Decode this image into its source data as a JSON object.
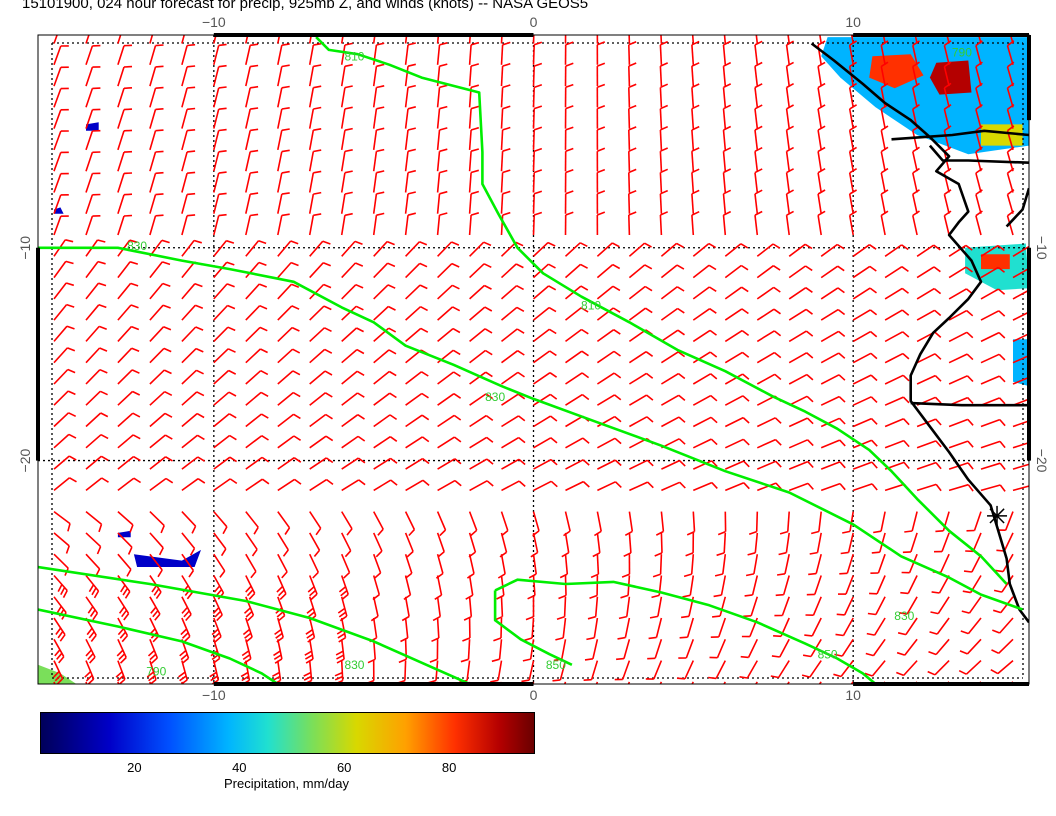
{
  "title": "15101900, 024 hour forecast for precip, 925mb Z, and winds (knots) -- NASA GEOS5",
  "lon_ticks": [
    {
      "value": -10,
      "label": "−10"
    },
    {
      "value": 0,
      "label": "0"
    },
    {
      "value": 10,
      "label": "10"
    }
  ],
  "lat_ticks": [
    {
      "value": -10,
      "label": "−10"
    },
    {
      "value": -20,
      "label": "−20"
    }
  ],
  "map_extent": {
    "lon_min": -15.5,
    "lon_max": 15.5,
    "lat_max": 0,
    "lat_min": -30.5
  },
  "contours": [
    {
      "label": "810",
      "color": "#00ee00",
      "points": [
        [
          -6.8,
          -0.1
        ],
        [
          -6.4,
          -0.7
        ],
        [
          -5.5,
          -0.9
        ],
        [
          -4.5,
          -1.4
        ],
        [
          -3.5,
          -2.0
        ],
        [
          -1.7,
          -2.7
        ],
        [
          -1.6,
          -5.5
        ],
        [
          -1.6,
          -7.0
        ],
        [
          -1.1,
          -8.4
        ],
        [
          -0.5,
          -10.0
        ],
        [
          0.3,
          -11.2
        ],
        [
          1.5,
          -12.3
        ],
        [
          3.0,
          -13.5
        ],
        [
          4.5,
          -14.8
        ],
        [
          6.0,
          -15.8
        ],
        [
          7.5,
          -17.0
        ],
        [
          8.5,
          -17.7
        ],
        [
          9.5,
          -18.5
        ],
        [
          10.5,
          -19.5
        ],
        [
          11.2,
          -20.5
        ],
        [
          12.0,
          -21.8
        ],
        [
          13.0,
          -23.3
        ],
        [
          14.0,
          -24.5
        ],
        [
          14.8,
          -25.8
        ]
      ]
    },
    {
      "label": "830",
      "color": "#00ee00",
      "points": [
        [
          -15.5,
          -10.0
        ],
        [
          -13.0,
          -10.0
        ],
        [
          -11.0,
          -10.6
        ],
        [
          -9.5,
          -11.0
        ],
        [
          -7.5,
          -11.6
        ],
        [
          -6.0,
          -12.8
        ],
        [
          -5.0,
          -13.5
        ],
        [
          -4.0,
          -14.6
        ],
        [
          -2.5,
          -15.5
        ],
        [
          -1.0,
          -16.5
        ],
        [
          0.0,
          -17.1
        ],
        [
          2.0,
          -18.2
        ],
        [
          4.0,
          -19.3
        ],
        [
          6.0,
          -20.5
        ],
        [
          8.0,
          -21.5
        ],
        [
          10.0,
          -23.0
        ],
        [
          11.5,
          -24.5
        ],
        [
          13.0,
          -25.5
        ],
        [
          14.0,
          -26.3
        ],
        [
          15.3,
          -27.0
        ]
      ]
    },
    {
      "label": "850",
      "color": "#00ee00",
      "points": [
        [
          -1.2,
          -26.1
        ],
        [
          -0.5,
          -25.6
        ],
        [
          1.0,
          -25.8
        ],
        [
          2.5,
          -25.7
        ],
        [
          4.0,
          -26.2
        ],
        [
          5.5,
          -26.8
        ],
        [
          7.0,
          -27.6
        ],
        [
          8.5,
          -28.6
        ],
        [
          9.5,
          -29.3
        ],
        [
          10.3,
          -30.0
        ],
        [
          10.7,
          -30.5
        ]
      ]
    },
    {
      "label": "850",
      "color": "#00ee00",
      "points": [
        [
          -1.2,
          -26.1
        ],
        [
          -1.2,
          -27.5
        ],
        [
          -0.4,
          -28.4
        ],
        [
          0.5,
          -29.1
        ],
        [
          1.2,
          -29.6
        ]
      ]
    },
    {
      "label": "830",
      "color": "#00ee00",
      "points": [
        [
          -15.5,
          -25.0
        ],
        [
          -12.0,
          -25.8
        ],
        [
          -9.0,
          -26.6
        ],
        [
          -7.0,
          -27.4
        ],
        [
          -5.0,
          -28.5
        ],
        [
          -3.5,
          -29.5
        ],
        [
          -2.0,
          -30.5
        ]
      ]
    },
    {
      "label": "790",
      "color": "#00ee00",
      "points": [
        [
          -15.5,
          -27.0
        ],
        [
          -13.0,
          -27.8
        ],
        [
          -11.0,
          -28.5
        ],
        [
          -9.5,
          -29.3
        ],
        [
          -8.5,
          -30.0
        ],
        [
          -8.0,
          -30.5
        ]
      ]
    }
  ],
  "contour_labels": [
    {
      "text": "810",
      "lon": -5.6,
      "lat": -1.2
    },
    {
      "text": "810",
      "lon": 1.8,
      "lat": -12.9
    },
    {
      "text": "830",
      "lon": -12.4,
      "lat": -10.1
    },
    {
      "text": "830",
      "lon": -1.2,
      "lat": -17.2
    },
    {
      "text": "830",
      "lon": 11.6,
      "lat": -27.5
    },
    {
      "text": "850",
      "lon": 9.2,
      "lat": -29.3
    },
    {
      "text": "850",
      "lon": 0.7,
      "lat": -29.8
    },
    {
      "text": "830",
      "lon": -5.6,
      "lat": -29.8
    },
    {
      "text": "790",
      "lon": -11.8,
      "lat": -30.1
    },
    {
      "text": "790",
      "lon": 13.4,
      "lat": -1.0
    }
  ],
  "precip_areas": [
    {
      "level": 30,
      "points": [
        [
          9.2,
          -0.1
        ],
        [
          15.5,
          -0.1
        ],
        [
          15.5,
          -5.2
        ],
        [
          13.6,
          -5.6
        ],
        [
          12.0,
          -4.7
        ],
        [
          10.7,
          -3.4
        ],
        [
          9.6,
          -2.0
        ],
        [
          9.0,
          -1.0
        ]
      ]
    },
    {
      "level": 75,
      "points": [
        [
          10.6,
          -1.0
        ],
        [
          11.8,
          -0.9
        ],
        [
          12.2,
          -1.9
        ],
        [
          11.3,
          -2.5
        ],
        [
          10.5,
          -2.0
        ]
      ]
    },
    {
      "level": 85,
      "points": [
        [
          12.6,
          -1.3
        ],
        [
          13.6,
          -1.2
        ],
        [
          13.7,
          -2.7
        ],
        [
          12.7,
          -2.8
        ],
        [
          12.4,
          -2.0
        ]
      ]
    },
    {
      "level": 55,
      "points": [
        [
          14.0,
          -4.2
        ],
        [
          15.3,
          -4.2
        ],
        [
          15.3,
          -5.2
        ],
        [
          14.0,
          -5.2
        ]
      ]
    },
    {
      "level": 40,
      "points": [
        [
          13.5,
          -10.0
        ],
        [
          15.4,
          -9.8
        ],
        [
          15.5,
          -11.9
        ],
        [
          14.5,
          -12.0
        ],
        [
          13.5,
          -11.2
        ]
      ]
    },
    {
      "level": 80,
      "points": [
        [
          14.0,
          -10.3
        ],
        [
          14.9,
          -10.3
        ],
        [
          14.9,
          -11.0
        ],
        [
          14.0,
          -11.0
        ]
      ]
    },
    {
      "level": 25,
      "points": [
        [
          15.0,
          -14.3
        ],
        [
          15.5,
          -14.3
        ],
        [
          15.5,
          -16.5
        ],
        [
          15.0,
          -16.3
        ]
      ]
    },
    {
      "level": 10,
      "points": [
        [
          -12.5,
          -24.4
        ],
        [
          -11.0,
          -24.7
        ],
        [
          -10.4,
          -24.2
        ],
        [
          -10.6,
          -25.0
        ],
        [
          -12.4,
          -25.0
        ]
      ]
    },
    {
      "level": 10,
      "points": [
        [
          -15.0,
          -8.2
        ],
        [
          -14.8,
          -8.1
        ],
        [
          -14.7,
          -8.4
        ],
        [
          -15.0,
          -8.4
        ]
      ]
    },
    {
      "level": 10,
      "points": [
        [
          -14.0,
          -4.2
        ],
        [
          -13.6,
          -4.1
        ],
        [
          -13.6,
          -4.5
        ],
        [
          -14.0,
          -4.5
        ]
      ]
    },
    {
      "level": 10,
      "points": [
        [
          -13.0,
          -23.4
        ],
        [
          -12.6,
          -23.3
        ],
        [
          -12.6,
          -23.6
        ],
        [
          -13.0,
          -23.6
        ]
      ]
    },
    {
      "level": 45,
      "points": [
        [
          -15.5,
          -29.6
        ],
        [
          -14.8,
          -30.0
        ],
        [
          -14.3,
          -30.5
        ],
        [
          -15.5,
          -30.5
        ]
      ]
    }
  ],
  "precip_scale_max": 96,
  "colorbar": {
    "ticks": [
      {
        "value": 20,
        "label": "20"
      },
      {
        "value": 40,
        "label": "40"
      },
      {
        "value": 60,
        "label": "60"
      },
      {
        "value": 80,
        "label": "80"
      }
    ],
    "min": 2,
    "max": 96,
    "label": "Precipitation, mm/day"
  },
  "coastline": [
    [
      8.7,
      -0.4
    ],
    [
      9.4,
      -1.2
    ],
    [
      10.3,
      -2.3
    ],
    [
      11.0,
      -3.2
    ],
    [
      11.8,
      -4.0
    ],
    [
      12.4,
      -4.8
    ],
    [
      13.0,
      -5.7
    ],
    [
      12.6,
      -6.4
    ],
    [
      13.3,
      -7.0
    ],
    [
      13.6,
      -8.3
    ],
    [
      13.3,
      -8.8
    ],
    [
      13.0,
      -9.4
    ],
    [
      13.7,
      -10.6
    ],
    [
      14.0,
      -11.6
    ],
    [
      13.6,
      -12.4
    ],
    [
      13.0,
      -13.3
    ],
    [
      12.5,
      -14.0
    ],
    [
      12.1,
      -15.0
    ],
    [
      11.8,
      -16.0
    ],
    [
      11.8,
      -17.2
    ],
    [
      12.3,
      -18.2
    ],
    [
      13.0,
      -19.6
    ],
    [
      13.6,
      -20.9
    ],
    [
      14.3,
      -22.1
    ],
    [
      14.5,
      -23.1
    ],
    [
      14.8,
      -24.6
    ],
    [
      14.9,
      -25.8
    ],
    [
      15.2,
      -27.0
    ],
    [
      15.5,
      -27.6
    ]
  ],
  "borders": [
    [
      [
        11.2,
        -4.9
      ],
      [
        12.2,
        -4.8
      ],
      [
        13.1,
        -4.7
      ],
      [
        14.1,
        -4.5
      ],
      [
        15.5,
        -4.7
      ]
    ],
    [
      [
        12.4,
        -5.2
      ],
      [
        12.8,
        -5.9
      ],
      [
        13.6,
        -5.9
      ],
      [
        15.5,
        -6.0
      ]
    ],
    [
      [
        11.8,
        -17.3
      ],
      [
        13.4,
        -17.4
      ],
      [
        15.5,
        -17.4
      ]
    ],
    [
      [
        15.5,
        -7.2
      ],
      [
        15.3,
        -8.2
      ],
      [
        14.8,
        -9.0
      ]
    ]
  ],
  "marker": {
    "label": "*",
    "lon": 14.5,
    "lat": -22.6
  },
  "wind_grid": {
    "lon_step": 1.0,
    "lat_step": 1.0
  }
}
